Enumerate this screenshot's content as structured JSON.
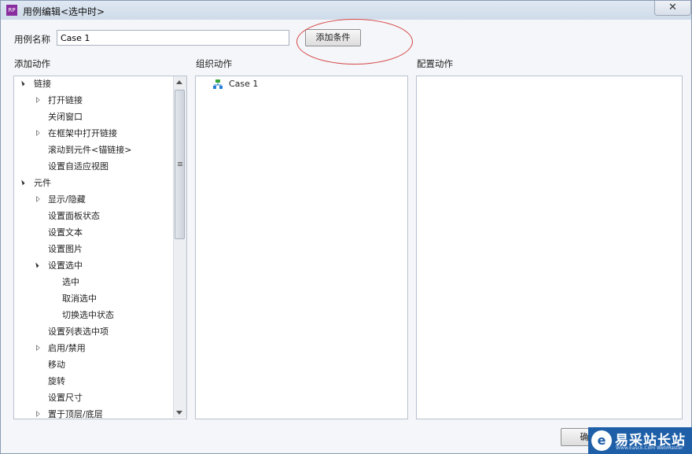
{
  "window": {
    "title": "用例编辑<选中时>",
    "app_icon": "RP",
    "close_label": "✕"
  },
  "case_name": {
    "label": "用例名称",
    "value": "Case 1"
  },
  "add_condition_label": "添加条件",
  "panels": {
    "add_actions": "添加动作",
    "organize_actions": "组织动作",
    "configure_actions": "配置动作"
  },
  "tree": [
    {
      "label": "链接",
      "level": 0,
      "expander": "open"
    },
    {
      "label": "打开链接",
      "level": 1,
      "expander": "closed"
    },
    {
      "label": "关闭窗口",
      "level": 1,
      "expander": "none"
    },
    {
      "label": "在框架中打开链接",
      "level": 1,
      "expander": "closed"
    },
    {
      "label": "滚动到元件<锚链接>",
      "level": 1,
      "expander": "none"
    },
    {
      "label": "设置自适应视图",
      "level": 1,
      "expander": "none"
    },
    {
      "label": "元件",
      "level": 0,
      "expander": "open"
    },
    {
      "label": "显示/隐藏",
      "level": 1,
      "expander": "closed"
    },
    {
      "label": "设置面板状态",
      "level": 1,
      "expander": "none"
    },
    {
      "label": "设置文本",
      "level": 1,
      "expander": "none"
    },
    {
      "label": "设置图片",
      "level": 1,
      "expander": "none"
    },
    {
      "label": "设置选中",
      "level": 1,
      "expander": "open"
    },
    {
      "label": "选中",
      "level": 2,
      "expander": "none"
    },
    {
      "label": "取消选中",
      "level": 2,
      "expander": "none"
    },
    {
      "label": "切换选中状态",
      "level": 2,
      "expander": "none"
    },
    {
      "label": "设置列表选中项",
      "level": 1,
      "expander": "none"
    },
    {
      "label": "启用/禁用",
      "level": 1,
      "expander": "closed"
    },
    {
      "label": "移动",
      "level": 1,
      "expander": "none"
    },
    {
      "label": "旋转",
      "level": 1,
      "expander": "none"
    },
    {
      "label": "设置尺寸",
      "level": 1,
      "expander": "none"
    },
    {
      "label": "置于顶层/底层",
      "level": 1,
      "expander": "closed"
    }
  ],
  "organize": {
    "case_label": "Case 1",
    "case_icon": "case-tree-icon"
  },
  "footer": {
    "ok_label": "确"
  },
  "watermark": {
    "logo": "e",
    "text": "易采站长站",
    "sub": "Www.Easck.Com  WebMaster"
  },
  "colors": {
    "highlight": "#d64545",
    "case_icon": "#3aa63a",
    "watermark_bg": "#1e5fa8"
  }
}
